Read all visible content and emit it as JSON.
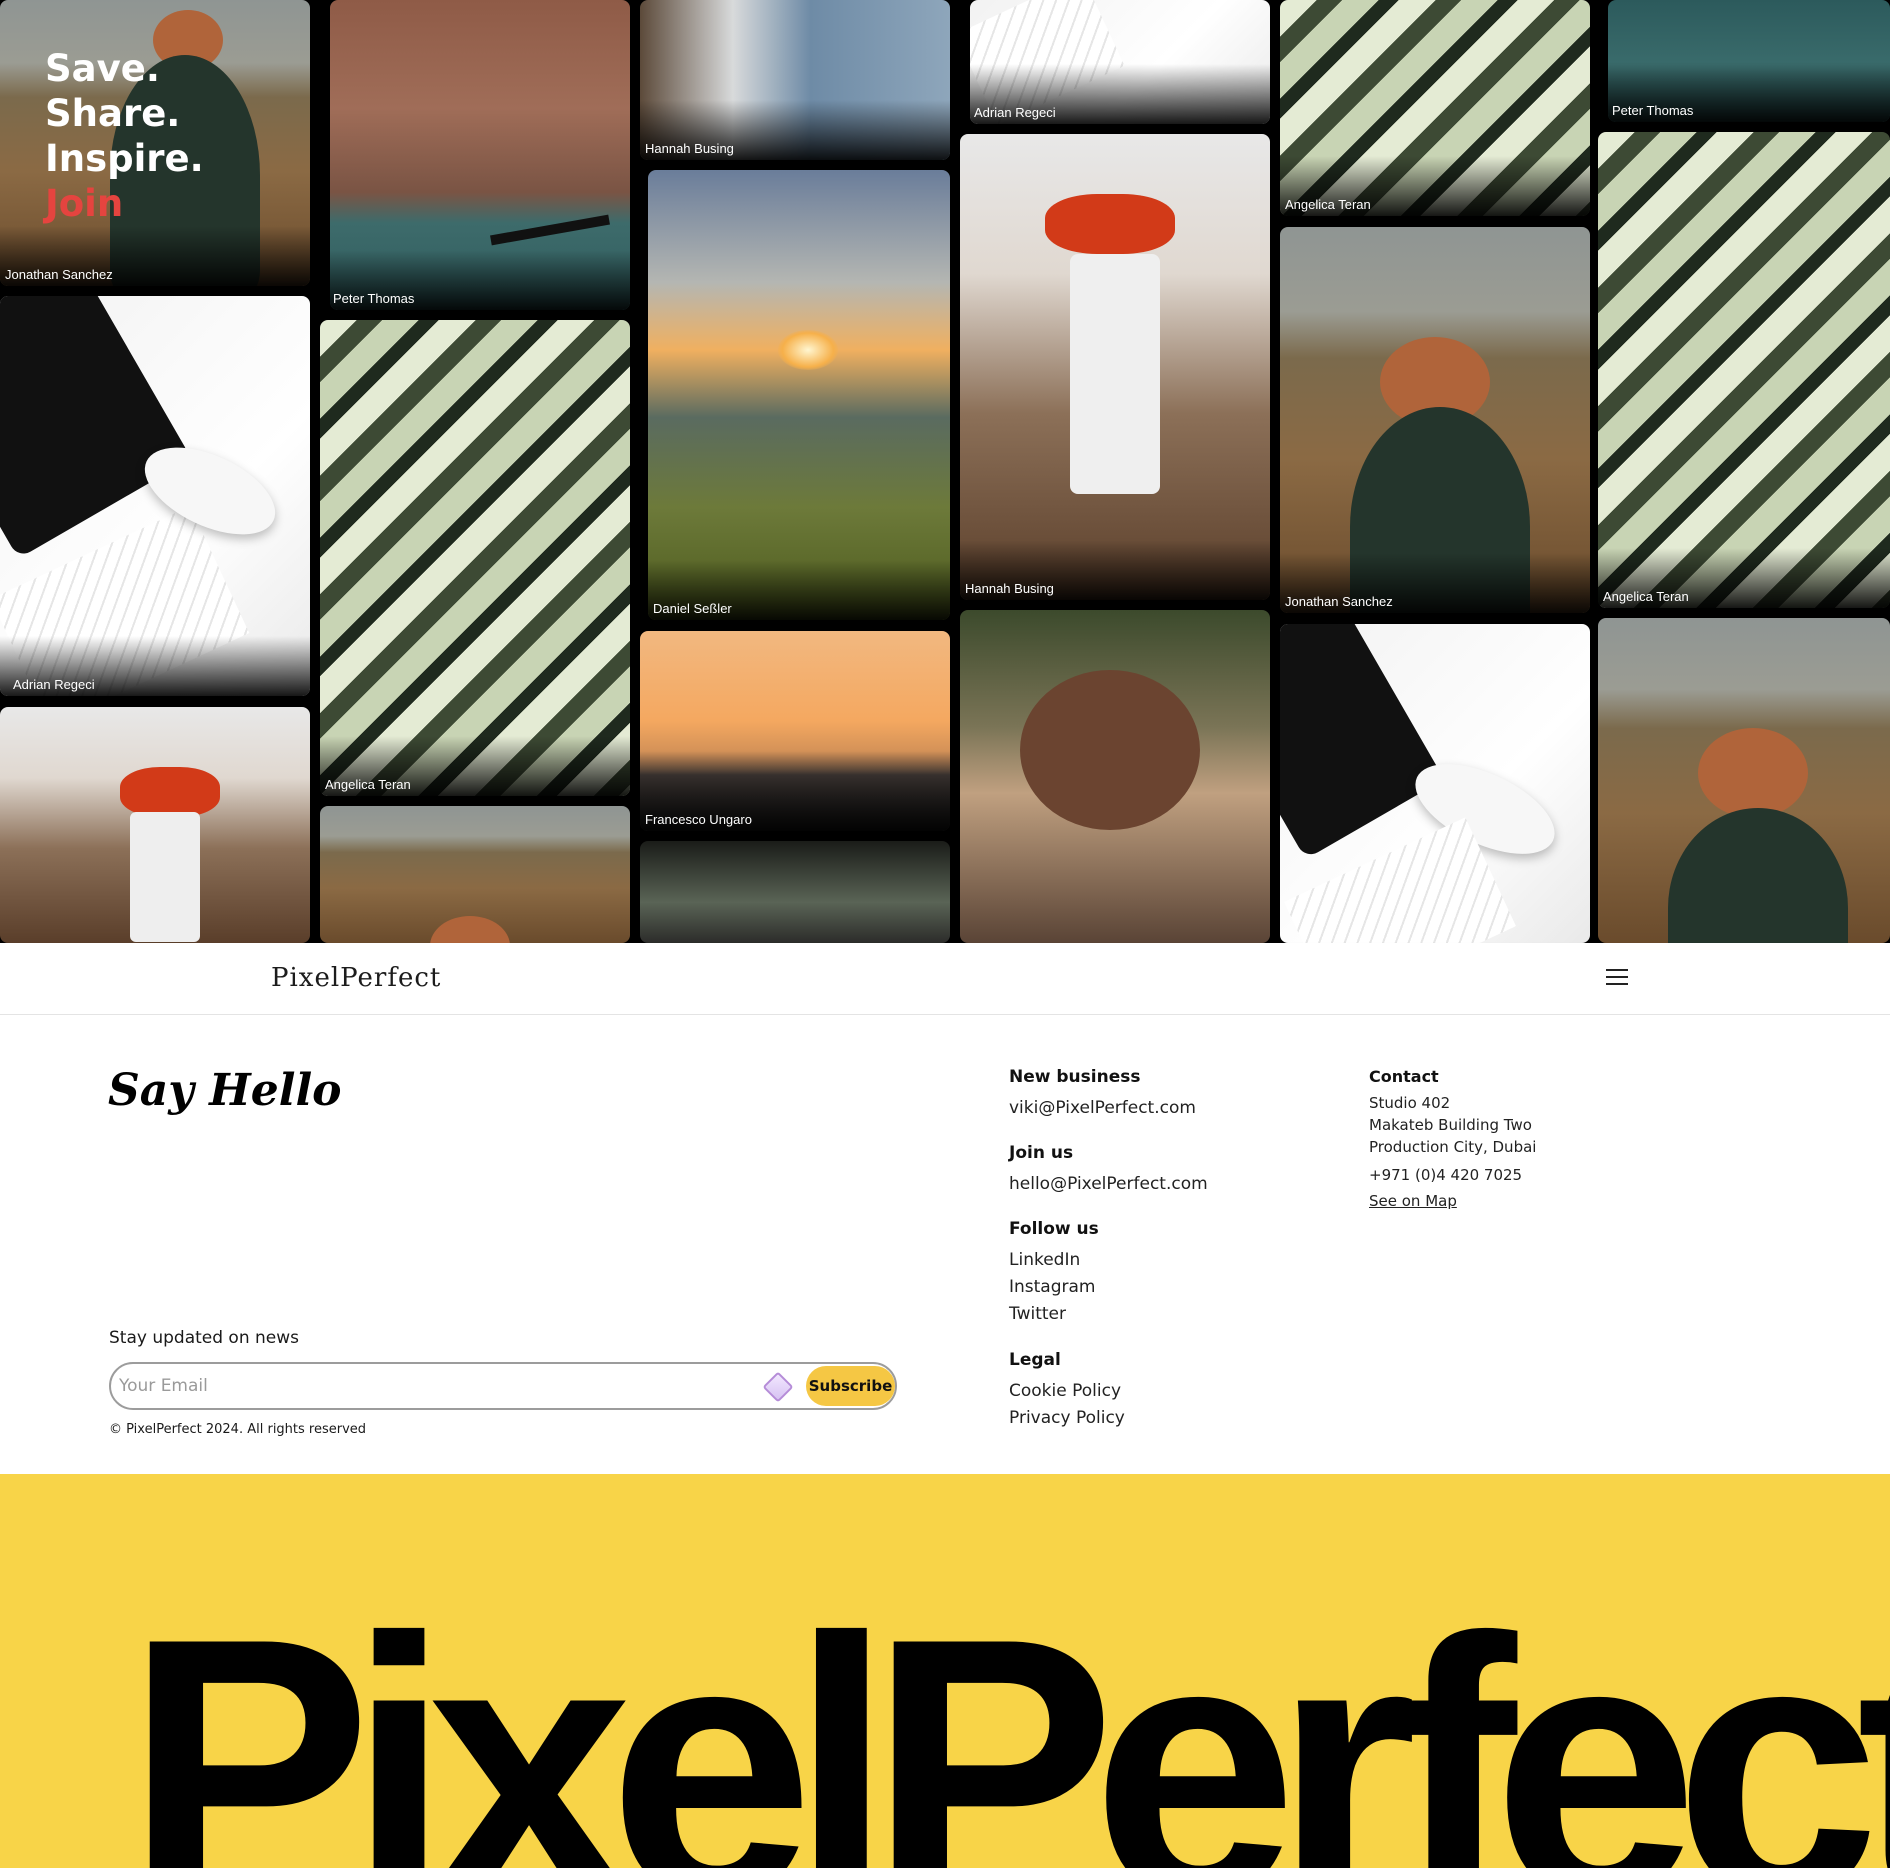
{
  "hero": {
    "line1": "Save.",
    "line2": "Share.",
    "line3": "Inspire.",
    "line4": "Join"
  },
  "captions": {
    "c1": "Jonathan Sanchez",
    "c2": "Peter Thomas",
    "c3": "Hannah Busing",
    "c4": "Adrian Regeci",
    "c5": "Angelica Teran",
    "c6": "Peter Thomas",
    "c7": "Adrian Regeci",
    "c8": "Angelica Teran",
    "c9": "Daniel Seßler",
    "c10": "Hannah Busing",
    "c11": "Jonathan Sanchez",
    "c12": "Angelica Teran",
    "c13": "Francesco Ungaro"
  },
  "nav": {
    "logo": "PixelPerfect"
  },
  "footer": {
    "say_hello": "Say Hello",
    "news_label": "Stay updated on news",
    "email_placeholder": "Your Email",
    "subscribe_label": "Subscribe",
    "copyright": "© PixelPerfect 2024. All rights reserved",
    "new_business": {
      "title": "New business",
      "email": "viki@PixelPerfect.com"
    },
    "join_us": {
      "title": "Join us",
      "email": "hello@PixelPerfect.com"
    },
    "follow_us": {
      "title": "Follow us",
      "links": [
        "LinkedIn",
        "Instagram",
        "Twitter"
      ]
    },
    "legal": {
      "title": "Legal",
      "links": [
        "Cookie Policy",
        "Privacy Policy"
      ]
    },
    "contact": {
      "title": "Contact",
      "address": [
        "Studio 402",
        "Makateb Building Two",
        "Production City, Dubai"
      ],
      "phone": "+971 (0)4 420 7025",
      "map_link": "See on Map"
    }
  },
  "banner": {
    "text": "PixelPerfect"
  },
  "colors": {
    "accent_yellow": "#f8d448",
    "join_red": "#e5443f",
    "button_yellow": "#f5c744"
  }
}
